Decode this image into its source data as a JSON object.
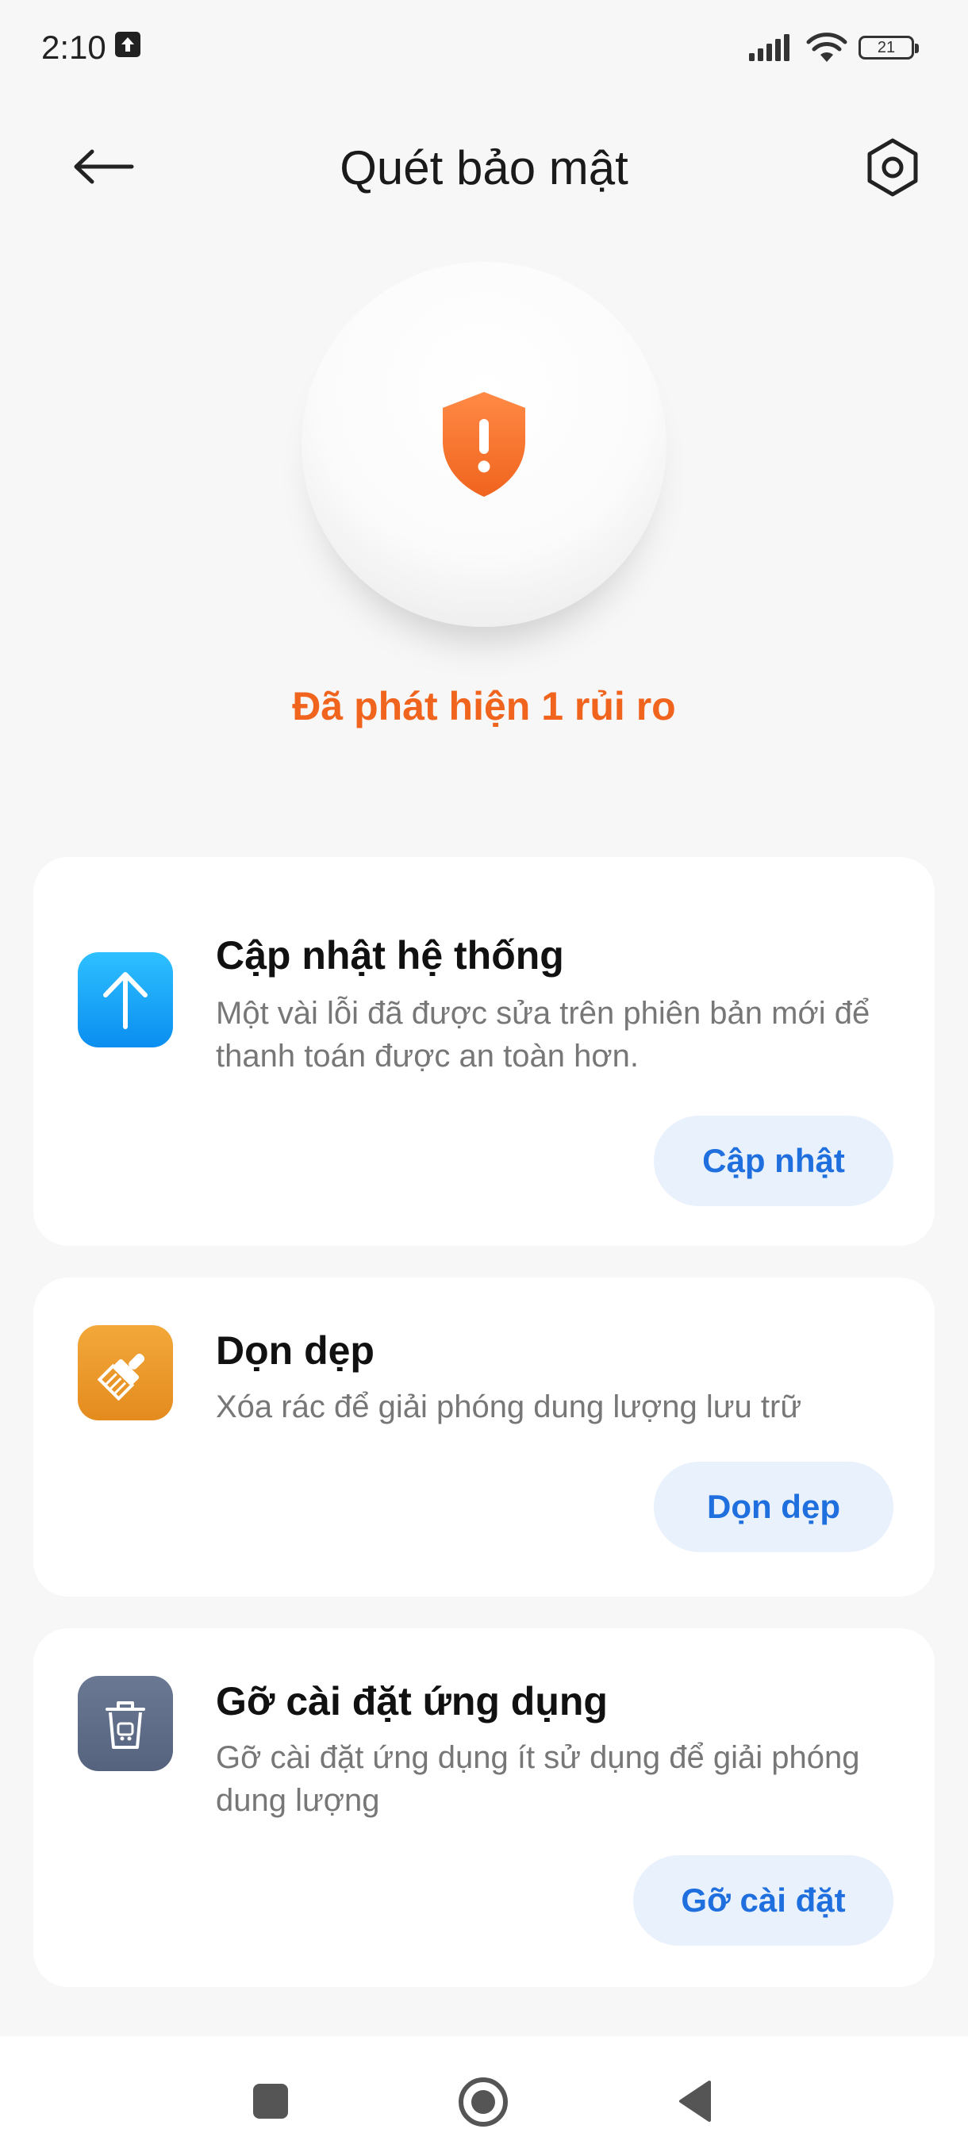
{
  "status_bar": {
    "time": "2:10",
    "battery": "21"
  },
  "header": {
    "title": "Quét bảo mật"
  },
  "scan": {
    "result_text": "Đã phát hiện 1 rủi ro",
    "accent_color": "#f0641e"
  },
  "cards": [
    {
      "title": "Cập nhật hệ thống",
      "description": "Một vài lỗi đã được sửa trên phiên bản mới để thanh toán được an toàn hơn.",
      "button_label": "Cập nhật",
      "icon": "arrow-up-icon",
      "icon_color": "#1aa3f5"
    },
    {
      "title": "Dọn dẹp",
      "description": "Xóa rác để giải phóng dung lượng lưu trữ",
      "button_label": "Dọn dẹp",
      "icon": "brush-icon",
      "icon_color": "#ea9a2a"
    },
    {
      "title": "Gỡ cài đặt ứng dụng",
      "description": "Gỡ cài đặt ứng dụng ít sử dụng để giải phóng dung lượng",
      "button_label": "Gỡ cài đặt",
      "icon": "trash-icon",
      "icon_color": "#5c6a85"
    }
  ],
  "colors": {
    "button_bg": "#e9f1fd",
    "button_text": "#1f6fde"
  }
}
